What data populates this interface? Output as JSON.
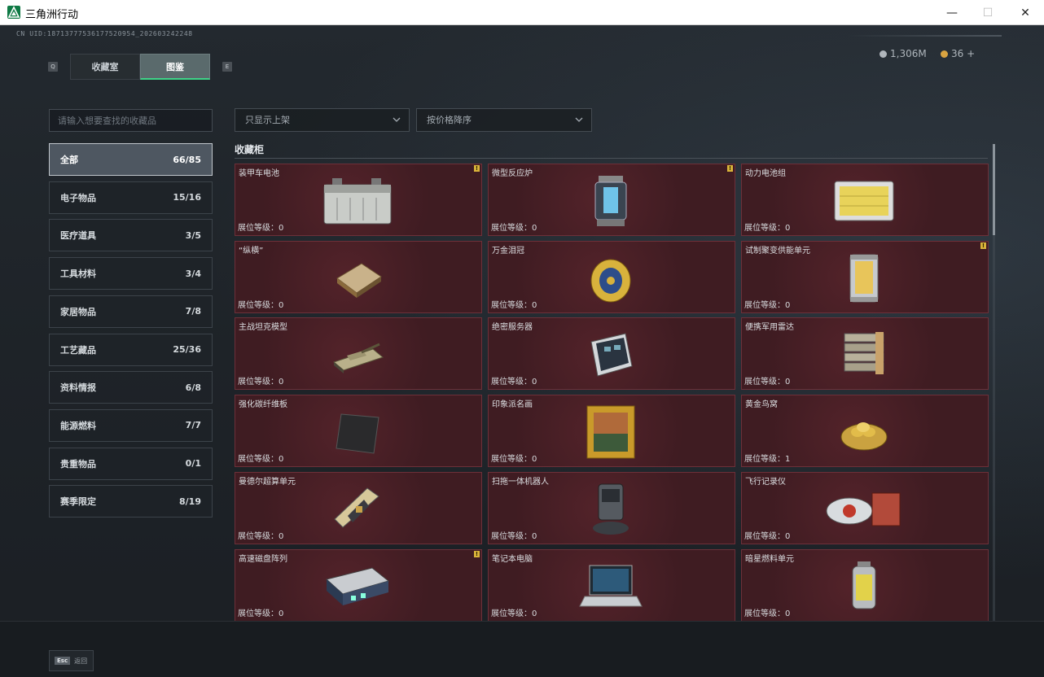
{
  "window": {
    "title": "三角洲行动",
    "minimize": "—",
    "maximize": "☐",
    "close": "✕"
  },
  "header": {
    "uid": "CN UID:18713777536177520954_202603242248",
    "q_key": "Q",
    "e_key": "E",
    "tabs": [
      {
        "label": "收藏室",
        "active": false
      },
      {
        "label": "图鉴",
        "active": true
      }
    ],
    "currency": [
      {
        "icon": "silver-coin-icon",
        "value": "1,306M",
        "color": "#b0b6bc"
      },
      {
        "icon": "gold-coin-icon",
        "value": "36 +",
        "color": "#d9a441"
      }
    ]
  },
  "search": {
    "placeholder": "请输入想要查找的收藏品"
  },
  "filters": {
    "display": "只显示上架",
    "sort": "按价格降序"
  },
  "categories": [
    {
      "label": "全部",
      "count": "66/85",
      "active": true
    },
    {
      "label": "电子物品",
      "count": "15/16"
    },
    {
      "label": "医疗道具",
      "count": "3/5"
    },
    {
      "label": "工具材料",
      "count": "3/4"
    },
    {
      "label": "家居物品",
      "count": "7/8"
    },
    {
      "label": "工艺藏品",
      "count": "25/36"
    },
    {
      "label": "资料情报",
      "count": "6/8"
    },
    {
      "label": "能源燃料",
      "count": "7/7"
    },
    {
      "label": "贵重物品",
      "count": "0/1"
    },
    {
      "label": "赛季限定",
      "count": "8/19"
    }
  ],
  "section": {
    "title": "收藏柜"
  },
  "level_prefix": "展位等级：",
  "items": [
    {
      "name": "装甲车电池",
      "level": "0",
      "badge": "!",
      "icon": "battery-icon"
    },
    {
      "name": "微型反应炉",
      "level": "0",
      "badge": "!",
      "icon": "reactor-icon"
    },
    {
      "name": "动力电池组",
      "level": "0",
      "badge": "",
      "icon": "battery-pack-icon"
    },
    {
      "name": "“纵横”",
      "level": "0",
      "badge": "",
      "icon": "chessboard-icon"
    },
    {
      "name": "万金泪冠",
      "level": "0",
      "badge": "",
      "icon": "jeweled-egg-icon"
    },
    {
      "name": "试制聚变供能单元",
      "level": "0",
      "badge": "!",
      "icon": "fusion-cell-icon"
    },
    {
      "name": "主战坦克模型",
      "level": "0",
      "badge": "",
      "icon": "tank-model-icon"
    },
    {
      "name": "绝密服务器",
      "level": "0",
      "badge": "",
      "icon": "server-icon"
    },
    {
      "name": "便携军用雷达",
      "level": "0",
      "badge": "",
      "icon": "radar-icon"
    },
    {
      "name": "强化碳纤维板",
      "level": "0",
      "badge": "",
      "icon": "carbon-plate-icon"
    },
    {
      "name": "印象派名画",
      "level": "0",
      "badge": "",
      "icon": "painting-icon"
    },
    {
      "name": "黄金鸟窝",
      "level": "1",
      "badge": "",
      "icon": "golden-nest-icon"
    },
    {
      "name": "曼德尔超算单元",
      "level": "0",
      "badge": "",
      "icon": "computing-unit-icon"
    },
    {
      "name": "扫拖一体机器人",
      "level": "0",
      "badge": "",
      "icon": "robot-vacuum-icon"
    },
    {
      "name": "飞行记录仪",
      "level": "0",
      "badge": "",
      "icon": "flight-recorder-icon"
    },
    {
      "name": "高速磁盘阵列",
      "level": "0",
      "badge": "!",
      "icon": "disk-array-icon"
    },
    {
      "name": "笔记本电脑",
      "level": "0",
      "badge": "",
      "icon": "laptop-icon"
    },
    {
      "name": "暗星燃料单元",
      "level": "0",
      "badge": "",
      "icon": "fuel-cell-icon"
    }
  ],
  "footer": {
    "esc_key": "Esc",
    "esc_label": "返回"
  }
}
